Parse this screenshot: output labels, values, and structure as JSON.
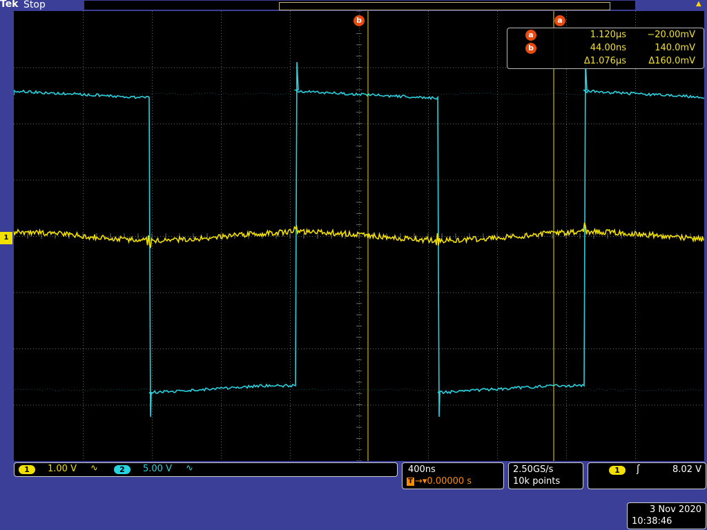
{
  "header": {
    "brand": "Tek",
    "run_state": "Stop"
  },
  "cursor_labels": {
    "a": "a",
    "b": "b"
  },
  "channel_marker": "1",
  "readout": {
    "a": {
      "label": "a",
      "time": "1.120µs",
      "value": "−20.00mV"
    },
    "b": {
      "label": "b",
      "time": "44.00ns",
      "value": "140.0mV"
    },
    "delta": {
      "time": "Δ1.076µs",
      "value": "Δ160.0mV"
    }
  },
  "channels": [
    {
      "num": "1",
      "scale": "1.00 V",
      "coupling": "∿",
      "color": "#f2e000"
    },
    {
      "num": "2",
      "scale": "5.00 V",
      "coupling": "∿",
      "color": "#27d3e0"
    }
  ],
  "horizontal": {
    "time_scale": "400ns",
    "trigger_badge": "T",
    "trigger_position": "→▾0.00000 s"
  },
  "acquisition": {
    "sample_rate": "2.50GS/s",
    "record_length": "10k points"
  },
  "trigger": {
    "source": "1",
    "slope_icon": "rising-edge-icon",
    "slope_glyph": "ʃ",
    "level": "8.02 V"
  },
  "datetime": {
    "date": "3 Nov 2020",
    "time": "10:38:46"
  },
  "colors": {
    "ch1": "#f2e000",
    "ch2": "#27d3e0",
    "cursor": "#e84a10",
    "graticule": "#6e6e6e"
  }
}
